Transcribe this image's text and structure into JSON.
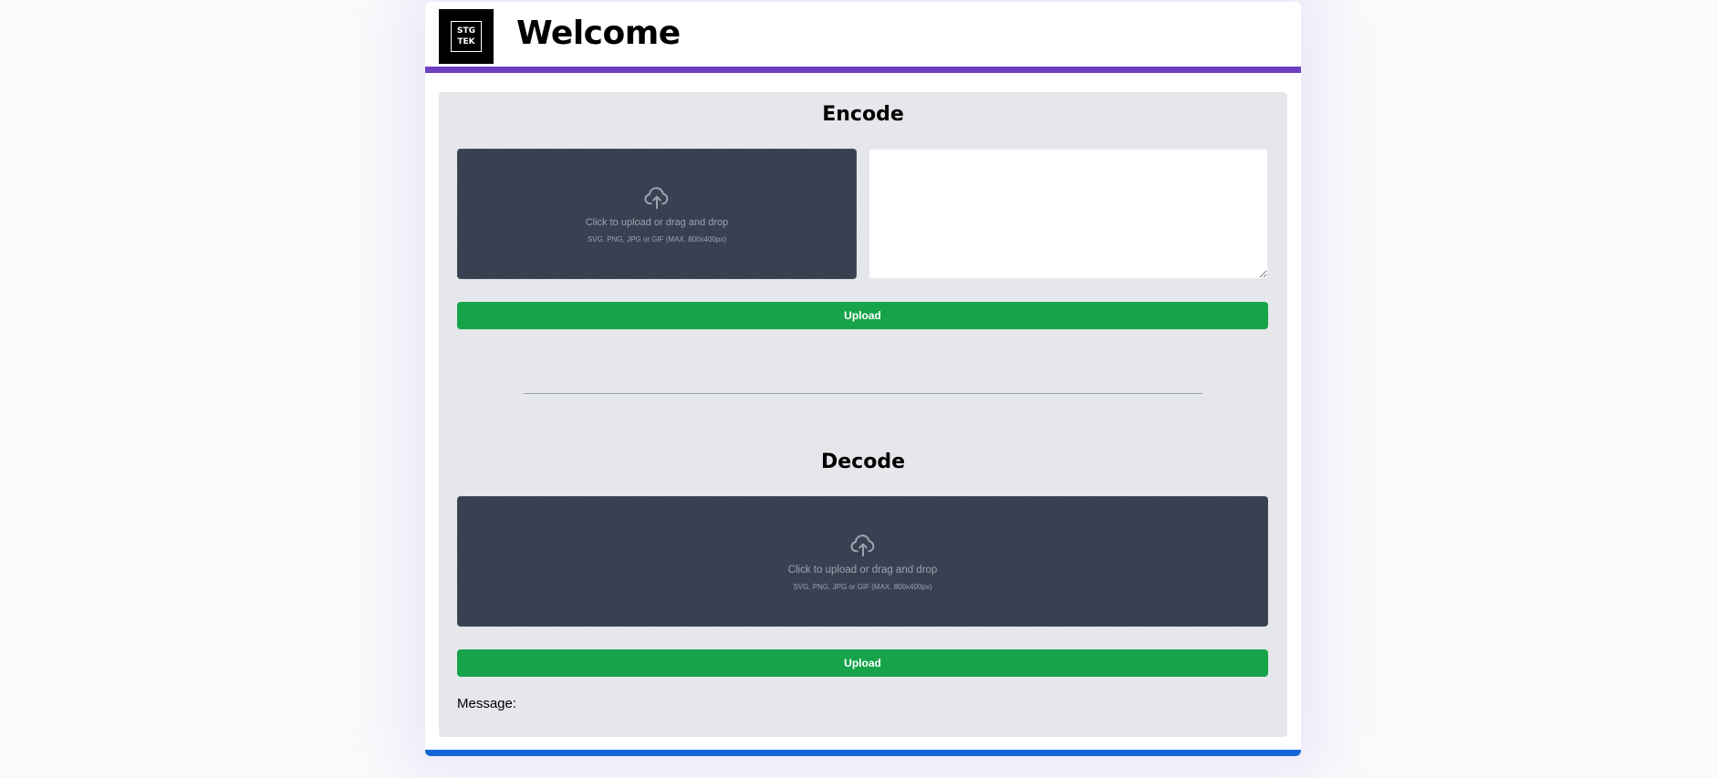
{
  "header": {
    "logo_line1": "STG",
    "logo_line2": "TEK",
    "title": "Welcome"
  },
  "encode": {
    "title": "Encode",
    "dropzone_main": "Click to upload or drag and drop",
    "dropzone_sub": "SVG, PNG, JPG or GIF (MAX. 800x400px)",
    "textarea_value": "",
    "upload_label": "Upload"
  },
  "decode": {
    "title": "Decode",
    "dropzone_main": "Click to upload or drag and drop",
    "dropzone_sub": "SVG, PNG, JPG or GIF (MAX. 800x400px)",
    "upload_label": "Upload",
    "message_label": "Message:"
  },
  "icons": {
    "upload": "cloud-upload-icon",
    "logo": "stgtek-logo"
  },
  "colors": {
    "header_accent": "#6d3fc1",
    "footer_accent": "#1366d6",
    "button": "#16a34a",
    "dropzone": "#374151",
    "panel": "#e5e7eb"
  }
}
